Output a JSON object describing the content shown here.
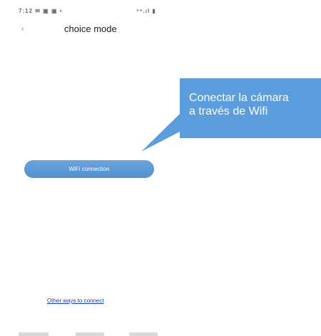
{
  "status_bar": {
    "left_text": "7:12 ✉ ▣ ▣ •",
    "right_text": "⁵⁵.ıl ▮"
  },
  "header": {
    "back_icon": "chevron-left-icon",
    "title": "choice mode"
  },
  "callout": {
    "line1": "Conectar la cámara",
    "line2": "a través de Wifi",
    "color": "#5c9ddd"
  },
  "wifi_button": {
    "label": "WiFi connection",
    "color": "#5c9ddd"
  },
  "other_link": {
    "label": "Other ways to connect",
    "color": "#1a3fa0"
  }
}
